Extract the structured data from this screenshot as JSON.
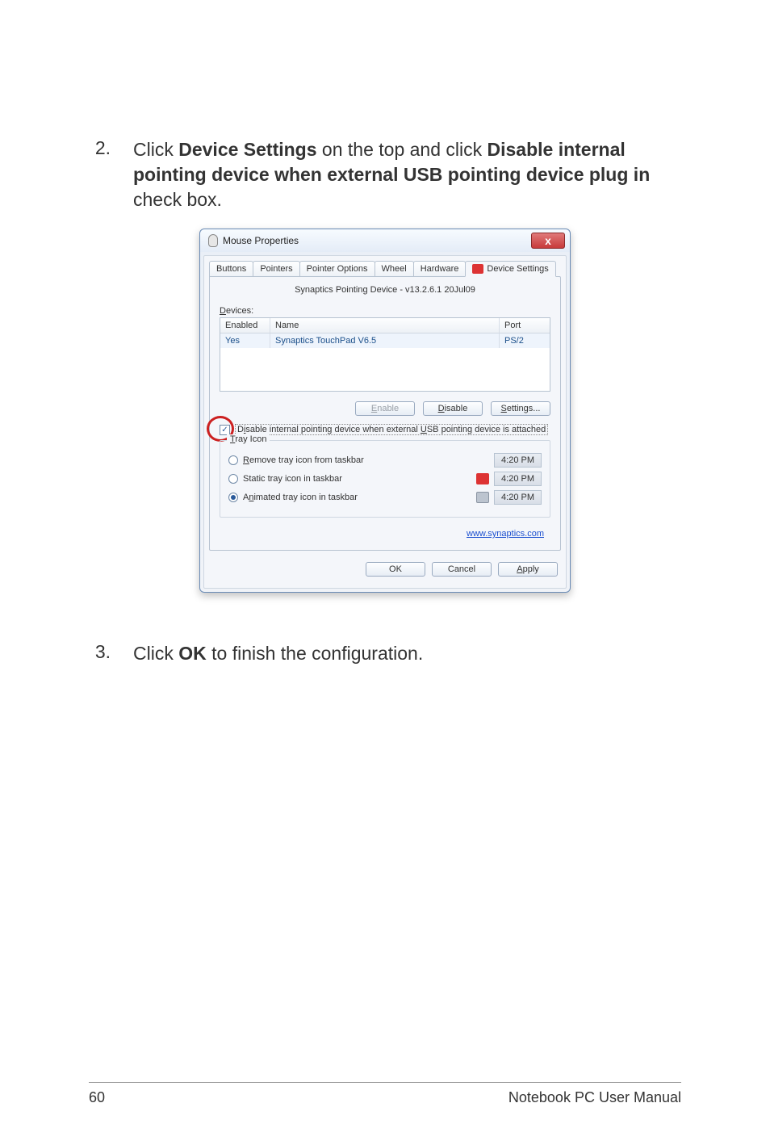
{
  "steps": {
    "s2": {
      "num": "2.",
      "pre": "Click ",
      "b1": "Device Settings",
      "mid": " on the top and click ",
      "b2": "Disable internal pointing device when external USB pointing device plug in",
      "post": " check box."
    },
    "s3": {
      "num": "3.",
      "pre": "Click ",
      "b1": "OK",
      "post": " to finish the configuration."
    }
  },
  "dialog": {
    "title": "Mouse Properties",
    "close": "x",
    "tabs": {
      "buttons": "Buttons",
      "pointers": "Pointers",
      "options": "Pointer Options",
      "wheel": "Wheel",
      "hardware": "Hardware",
      "device": "Device Settings"
    },
    "version": "Synaptics Pointing Device - v13.2.6.1 20Jul09",
    "devices_label": "Devices:",
    "table": {
      "h_enabled": "Enabled",
      "h_name": "Name",
      "h_port": "Port",
      "r_enabled": "Yes",
      "r_name": "Synaptics TouchPad V6.5",
      "r_port": "PS/2"
    },
    "buttons_mid": {
      "enable": "Enable",
      "disable": "Disable",
      "settings": "Settings..."
    },
    "checkbox_label": "Disable internal pointing device when external USB pointing device is attached",
    "tray": {
      "legend": "Tray Icon",
      "opt1": "Remove tray icon from taskbar",
      "opt2": "Static tray icon in taskbar",
      "opt3": "Animated tray icon in taskbar",
      "time1": "4:20 PM",
      "time2": "4:20 PM",
      "time3": "4:20 PM"
    },
    "link": "www.synaptics.com",
    "footer": {
      "ok": "OK",
      "cancel": "Cancel",
      "apply": "Apply"
    }
  },
  "page_footer": {
    "num": "60",
    "text": "Notebook PC User Manual"
  }
}
